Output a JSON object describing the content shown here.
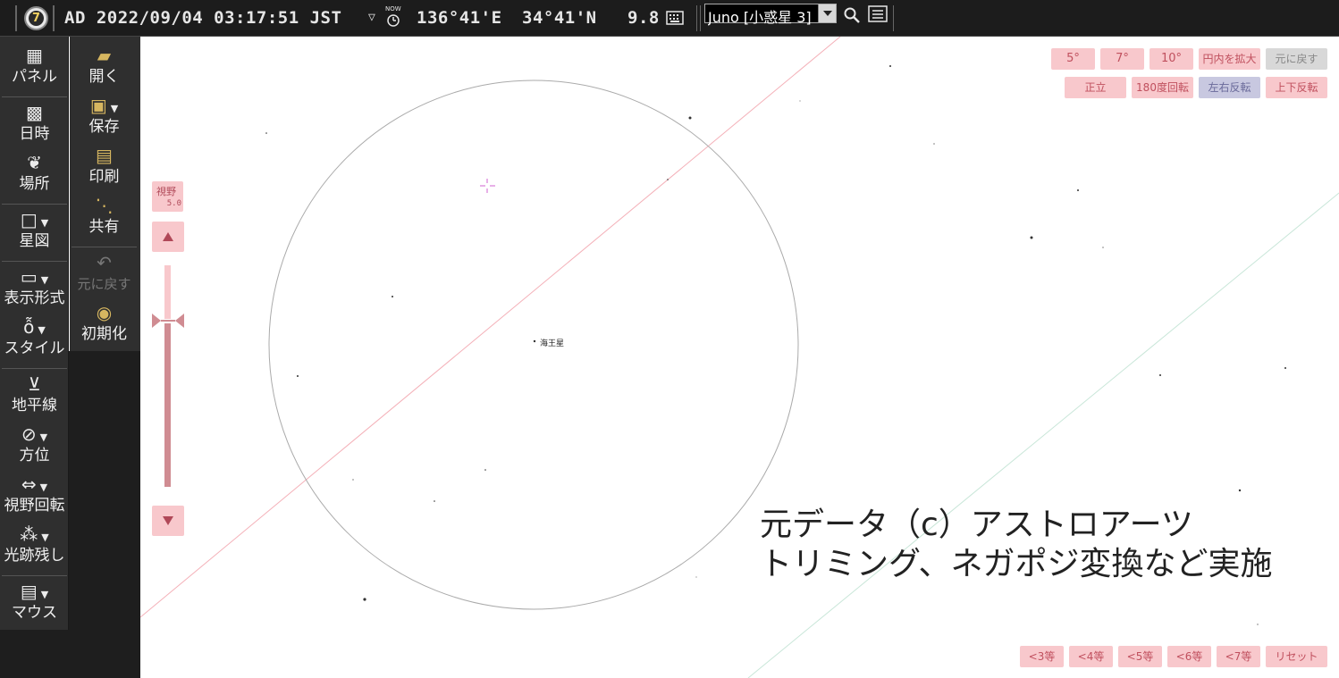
{
  "topbar": {
    "logo_glyph": "7",
    "datetime": "AD 2022/09/04 03:17:51 JST",
    "dst_marker": "▽",
    "now_icon_label": "NOW",
    "longitude": "136°41'E",
    "latitude": "34°41'N",
    "magnitude_limit": "9.8",
    "search_value": "Juno [小惑星 3]"
  },
  "panel_left": [
    {
      "label": "パネル",
      "icon": "grid-icon"
    },
    {
      "label": "日時",
      "icon": "calendar-clock-icon"
    },
    {
      "label": "場所",
      "icon": "location-icon"
    },
    {
      "label": "星図",
      "icon": "star-chart-icon"
    },
    {
      "label": "表示形式",
      "icon": "display-format-icon"
    },
    {
      "label": "スタイル",
      "icon": "binoculars-icon"
    },
    {
      "label": "地平線",
      "icon": "horizon-icon"
    },
    {
      "label": "方位",
      "icon": "compass-icon"
    },
    {
      "label": "視野回転",
      "icon": "rotate-view-icon"
    },
    {
      "label": "光跡残し",
      "icon": "trail-icon"
    },
    {
      "label": "マウス",
      "icon": "mouse-icon"
    }
  ],
  "panel_file": [
    {
      "label": "開く",
      "icon": "folder-open-icon"
    },
    {
      "label": "保存",
      "icon": "save-icon"
    },
    {
      "label": "印刷",
      "icon": "printer-icon"
    },
    {
      "label": "共有",
      "icon": "share-icon"
    },
    {
      "label": "元に戻す",
      "icon": "undo-icon"
    },
    {
      "label": "初期化",
      "icon": "reset-icon"
    }
  ],
  "fov": {
    "title": "視野",
    "value": "5.0"
  },
  "fov_buttons": [
    "5°",
    "7°",
    "10°",
    "円内を拡大",
    "元に戻す"
  ],
  "orientation_buttons": [
    "正立",
    "180度回転",
    "左右反転",
    "上下反転"
  ],
  "magnitude_buttons": [
    "<3等",
    "<4等",
    "<5等",
    "<6等",
    "<7等",
    "リセット"
  ],
  "sky": {
    "planet_label": "海王星"
  },
  "caption": {
    "line1": "元データ（c）アストロアーツ",
    "line2": "トリミング、ネガポジ変換など実施"
  },
  "colors": {
    "button_pink": "#f8c8cc",
    "button_text": "#c0505e",
    "panel_bg": "#2f2f2f",
    "topbar_bg": "#1c1c1c"
  }
}
